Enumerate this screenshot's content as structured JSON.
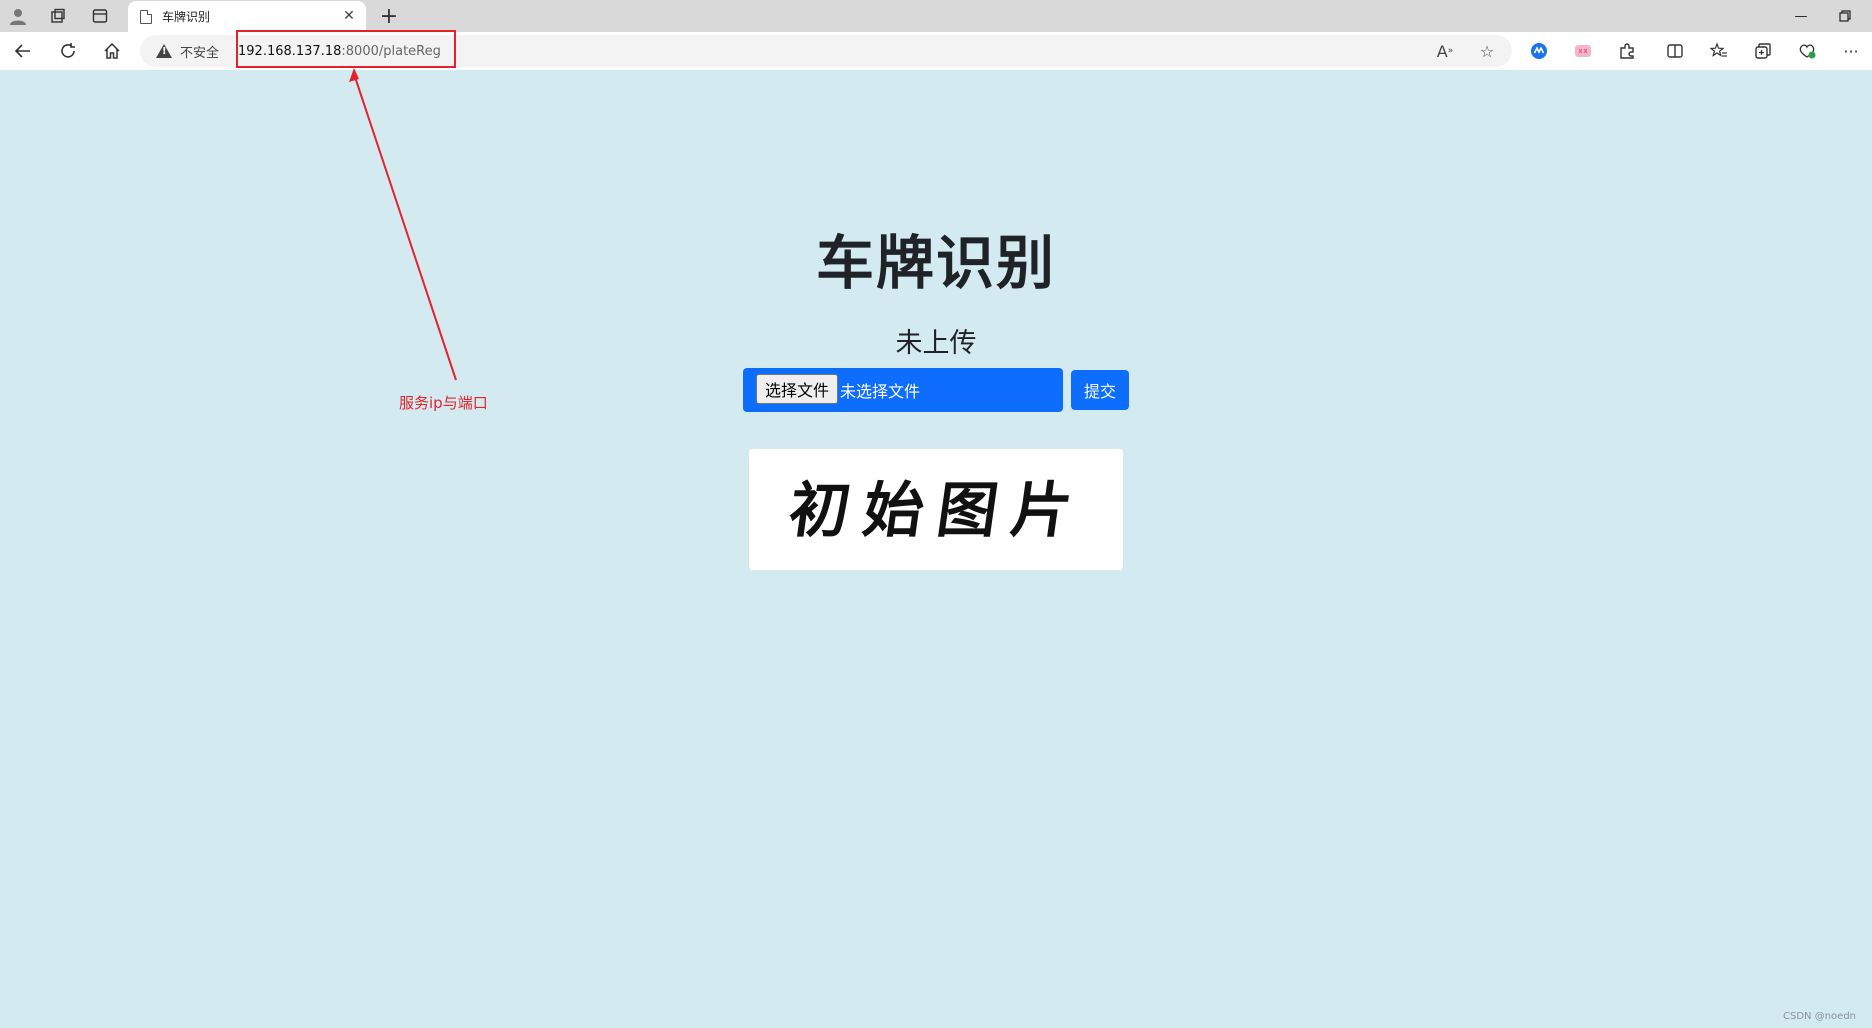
{
  "browser": {
    "tab_title": "车牌识别",
    "security_label": "不安全",
    "url_host": "192.168.137.18",
    "url_path": ":8000/plateReg"
  },
  "page": {
    "title": "车牌识别",
    "upload_status": "未上传",
    "file_button_label": "选择文件",
    "file_placeholder": "未选择文件",
    "submit_label": "提交",
    "preview_text": "初始图片"
  },
  "annotation": {
    "label": "服务ip与端口",
    "color": "#e5222b"
  },
  "watermark": "CSDN @noedn",
  "colors": {
    "page_background": "#d4eaf1",
    "primary_button": "#0d6efd"
  }
}
